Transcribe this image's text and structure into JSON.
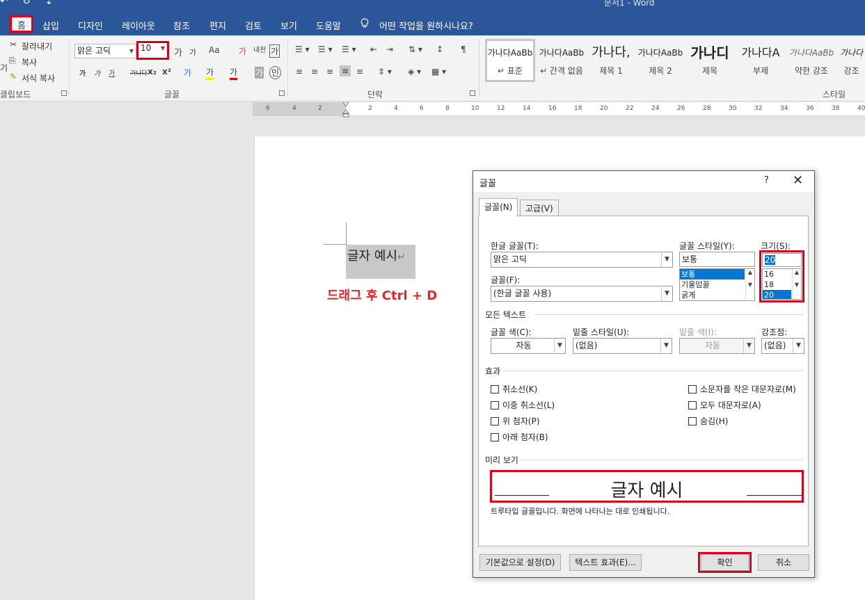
{
  "window": {
    "title": "문서1 - Word",
    "quick_access": "↶ ↻ ⇣"
  },
  "tabs": [
    {
      "id": "home",
      "label": "홈"
    },
    {
      "id": "insert",
      "label": "삽입"
    },
    {
      "id": "design",
      "label": "디자인"
    },
    {
      "id": "layout",
      "label": "레이아웃"
    },
    {
      "id": "references",
      "label": "참조"
    },
    {
      "id": "mailings",
      "label": "편지"
    },
    {
      "id": "review",
      "label": "검토"
    },
    {
      "id": "view",
      "label": "보기"
    },
    {
      "id": "help",
      "label": "도움말"
    },
    {
      "id": "tellme",
      "label": "어떤 작업을 원하시나요?",
      "icon": "lightbulb-icon"
    }
  ],
  "ribbon": {
    "clipboard": {
      "cut": "잘라내기",
      "copy": "복사",
      "format_painter": "서식 복사",
      "group": "클립보드",
      "partial_left": "기"
    },
    "font": {
      "font_name": "맑은 고딕",
      "font_size": "10",
      "grow": "가",
      "shrink": "가",
      "change_case": "Aa",
      "clear_format": "가",
      "phonetic": "내천",
      "char_border": "가",
      "bold": "가",
      "italic": "가",
      "underline": "가",
      "strike": "가나다",
      "subscript": "x₂",
      "superscript": "x²",
      "text_effect": "가",
      "highlight": "가",
      "font_color": "가",
      "char_shading": "가",
      "enclosed": "인",
      "group": "글꼴"
    },
    "paragraph": {
      "group": "단락"
    },
    "styles": {
      "group": "스타일",
      "items": [
        {
          "sample": "가나다AaBb",
          "name": "↵ 표준"
        },
        {
          "sample": "가나다AaBb",
          "name": "↵ 간격 없음"
        },
        {
          "sample": "가나다,",
          "name": "제목 1"
        },
        {
          "sample": "가나다AaBb",
          "name": "제목 2"
        },
        {
          "sample": "가나디",
          "name": "제목"
        },
        {
          "sample": "가나다A",
          "name": "부제"
        },
        {
          "sample": "가나다AaBb",
          "name": "약한 강조"
        },
        {
          "sample": "가나다",
          "name": "강조"
        }
      ]
    }
  },
  "ruler": {
    "left_numbers": [
      "6",
      "4",
      "2"
    ],
    "right_numbers": [
      "2",
      "4",
      "6",
      "8",
      "10",
      "12",
      "14",
      "16",
      "18",
      "20",
      "22",
      "24",
      "26",
      "28",
      "30",
      "32",
      "34",
      "36",
      "38",
      "40"
    ]
  },
  "document": {
    "selected_text": "글자 예시",
    "pilcrow": "↵",
    "instruction": "드래그 후 Ctrl + D"
  },
  "dialog": {
    "title": "글꼴",
    "help": "?",
    "close": "✕",
    "tabs": [
      "글꼴(N)",
      "고급(V)"
    ],
    "hangul_font_label": "한글 글꼴(T):",
    "hangul_font_value": "맑은 고딕",
    "font_label": "글꼴(F):",
    "font_value": "(한글 글꼴 사용)",
    "style_label": "글꼴 스타일(Y):",
    "style_value": "보통",
    "style_options": [
      "보통",
      "기울임꼴",
      "굵게"
    ],
    "size_label": "크기(S):",
    "size_value": "20",
    "size_options": [
      "16",
      "18",
      "20"
    ],
    "all_text": "모든 텍스트",
    "font_color_label": "글꼴 색(C):",
    "font_color_value": "자동",
    "underline_label": "밑줄 스타일(U):",
    "underline_value": "(없음)",
    "underline_color_label": "밑줄 색(I):",
    "underline_color_value": "자동",
    "emphasis_label": "강조점:",
    "emphasis_value": "(없음)",
    "effects": "효과",
    "effects_left": [
      "취소선(K)",
      "이중 취소선(L)",
      "위 첨자(P)",
      "아래 첨자(B)"
    ],
    "effects_right": [
      "소문자를 작은 대문자로(M)",
      "모두 대문자로(A)",
      "숨김(H)"
    ],
    "preview_label": "미리 보기",
    "preview_text": "글자 예시",
    "truetype_note": "트루타입 글꼴입니다. 화면에 나타나는 대로 인쇄됩니다.",
    "buttons": {
      "set_default": "기본값으로 설정(D)",
      "text_effects": "텍스트 효과(E)...",
      "ok": "확인",
      "cancel": "취소"
    }
  },
  "colors": {
    "word_blue": "#2b579a",
    "highlight_red": "#d9001b",
    "instruction_red": "#e0262b",
    "selection_blue": "#0078d7"
  }
}
